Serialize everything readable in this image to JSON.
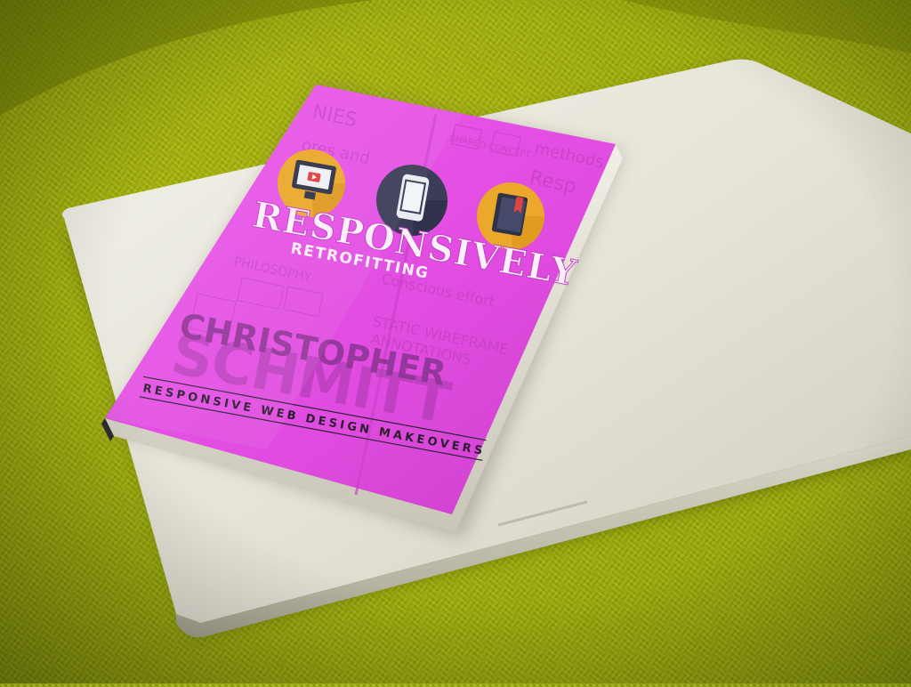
{
  "scene": {
    "fabric_color": "#9eae0a",
    "laptop_color": "#e9e7dc",
    "cover_color": "#e04ce0"
  },
  "book": {
    "title_line1": "RESPONSIVELY",
    "title_line2": "RETROFITTING",
    "author_first": "CHRISTOPHER",
    "author_last": "SCHMITT",
    "subtitle": "RESPONSIVE WEB DESIGN MAKEOVERS",
    "sketch_words": [
      "NIES",
      "ores and",
      "PHILOSOPHY",
      "Conscious effort",
      "STATIC WIREFRAME",
      "ANNOTATIONS",
      "methods",
      "Resp",
      "SHARED CONCEPT"
    ],
    "icons": [
      "monitor-video-icon",
      "smartphone-icon",
      "book-bookmark-icon"
    ]
  }
}
